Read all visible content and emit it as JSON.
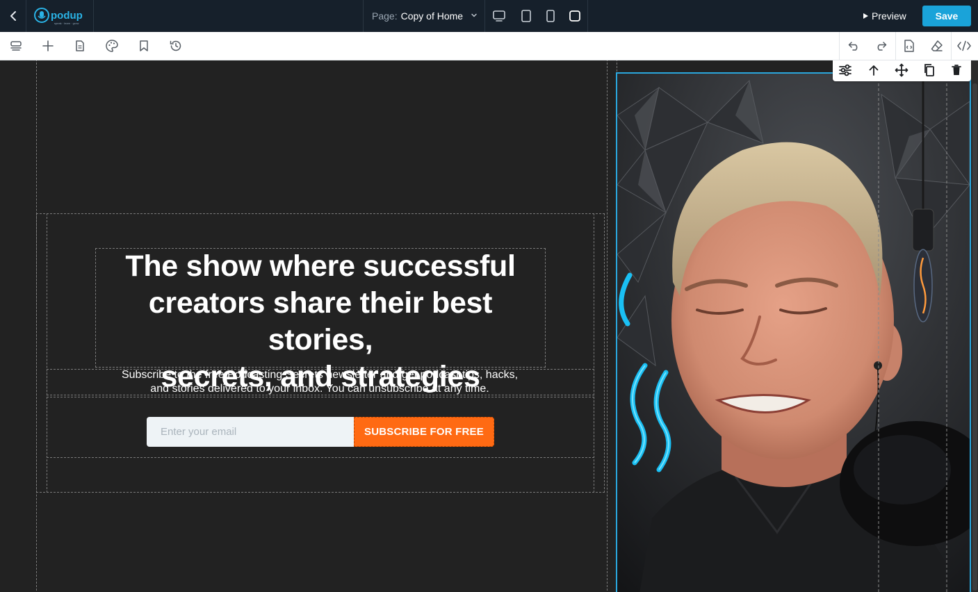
{
  "app": {
    "logo_text": "podup",
    "logo_tagline": "speak · learn · grow"
  },
  "topbar": {
    "page_label": "Page:",
    "page_value": "Copy of Home",
    "preview_label": "Preview",
    "save_label": "Save",
    "devices": [
      "desktop-icon",
      "tablet-icon",
      "mobile-icon",
      "square-icon"
    ]
  },
  "toolbar": {
    "left_tools": [
      "layers-icon",
      "plus-icon",
      "page-icon",
      "palette-icon",
      "bookmark-icon",
      "history-icon"
    ],
    "right_tools": [
      "undo-icon",
      "redo-icon",
      "code-file-icon",
      "eraser-icon",
      "code-icon"
    ]
  },
  "element_toolbar": {
    "tools": [
      "settings-sliders-icon",
      "arrow-up-icon",
      "move-icon",
      "copy-icon",
      "trash-icon"
    ]
  },
  "hero": {
    "headline_line1": "The show where successful",
    "headline_line2": "creators share their best stories,",
    "headline_line3": "secrets, and strategies",
    "subtext_line1": "Subscribe to the free Podcasting Secrets newsletter and get podcast tips, hacks,",
    "subtext_line2": "and stories delivered to your inbox. You can unsubscribe at any time.",
    "email_placeholder": "Enter your email",
    "subscribe_label": "SUBSCRIBE FOR FREE"
  },
  "colors": {
    "topbar_bg": "#16202b",
    "canvas_bg": "#222222",
    "save_accent": "#1aa3d9",
    "cta_orange": "#ff6a13",
    "selection_blue": "#2aa7dd"
  }
}
